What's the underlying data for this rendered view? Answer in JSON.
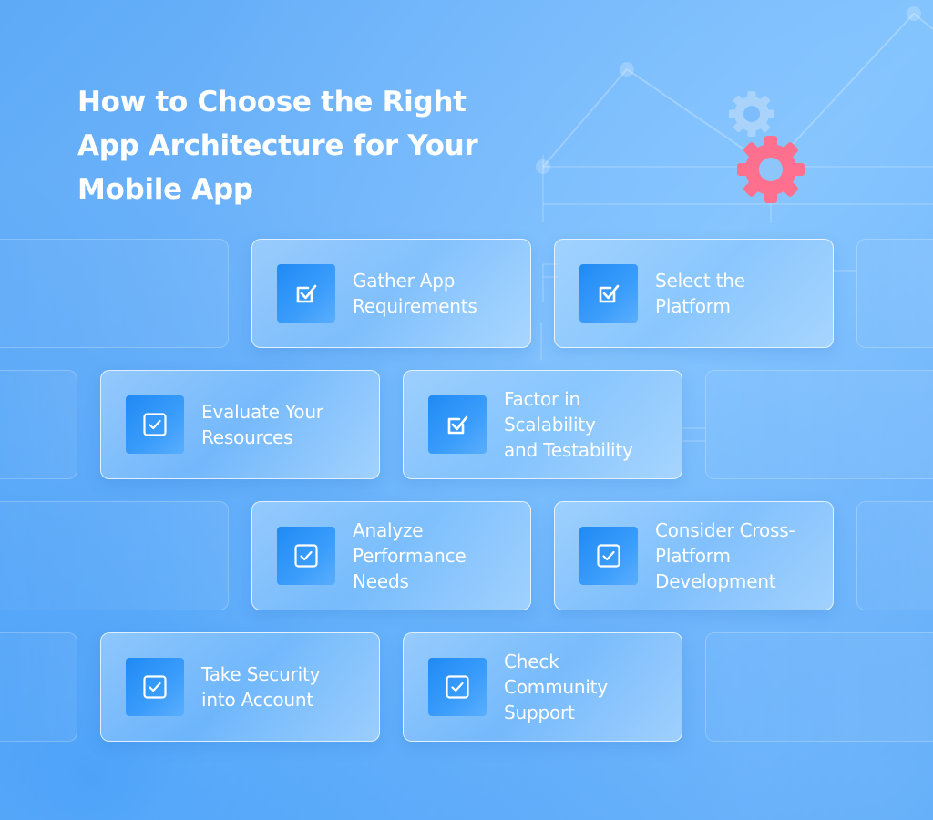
{
  "title": "How to Choose the Right App Architecture for Your Mobile App",
  "colors": {
    "background_accent": "#72b6fb",
    "icon_box": "#1f8af5",
    "gear_primary": "#ff6f8e",
    "gear_secondary": "#a9d3fb",
    "text": "#ffffff"
  },
  "decorations": {
    "gear_icons": [
      "gear-icon-light",
      "gear-icon-pink"
    ],
    "line_chart_motif": "trend-line"
  },
  "steps": [
    {
      "label": "Gather App\nRequirements",
      "icon": "checkbox-checked-icon"
    },
    {
      "label": "Select the\nPlatform",
      "icon": "checkbox-checked-icon"
    },
    {
      "label": "Evaluate Your\nResources",
      "icon": "checkbox-rounded-check-icon"
    },
    {
      "label": "Factor in\nScalability\nand Testability",
      "icon": "checkbox-checked-icon"
    },
    {
      "label": "Analyze\nPerformance\nNeeds",
      "icon": "checkbox-rounded-check-icon"
    },
    {
      "label": "Consider Cross-\nPlatform\nDevelopment",
      "icon": "checkbox-rounded-check-icon"
    },
    {
      "label": "Take Security\ninto Account",
      "icon": "checkbox-rounded-check-icon"
    },
    {
      "label": "Check\nCommunity\nSupport",
      "icon": "checkbox-rounded-check-icon"
    }
  ]
}
